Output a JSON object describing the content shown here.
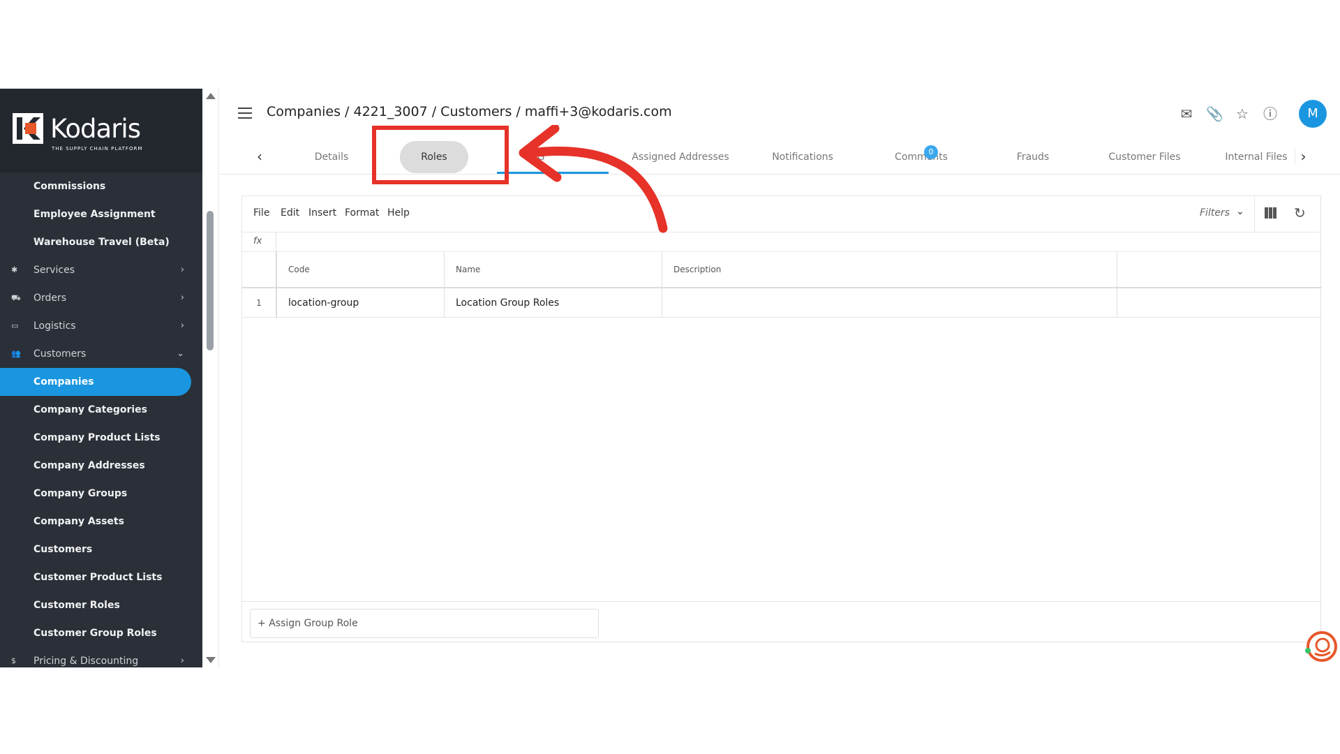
{
  "logo": {
    "name": "Kodaris",
    "tagline": "THE SUPPLY CHAIN PLATFORM",
    "brand_color": "#e6572a"
  },
  "sidebar": {
    "items": [
      {
        "label": "Commissions",
        "kind": "sub"
      },
      {
        "label": "Employee Assignment",
        "kind": "sub"
      },
      {
        "label": "Warehouse Travel (Beta)",
        "kind": "sub"
      },
      {
        "label": "Services",
        "kind": "top",
        "icon": "services-icon",
        "chevron": "›"
      },
      {
        "label": "Orders",
        "kind": "top",
        "icon": "truck-icon",
        "chevron": "›"
      },
      {
        "label": "Logistics",
        "kind": "top",
        "icon": "shipping-icon",
        "chevron": "›"
      },
      {
        "label": "Customers",
        "kind": "top",
        "icon": "users-icon",
        "chevron": "⌄"
      },
      {
        "label": "Companies",
        "kind": "active"
      },
      {
        "label": "Company Categories",
        "kind": "sub"
      },
      {
        "label": "Company Product Lists",
        "kind": "sub"
      },
      {
        "label": "Company Addresses",
        "kind": "sub"
      },
      {
        "label": "Company Groups",
        "kind": "sub"
      },
      {
        "label": "Company Assets",
        "kind": "sub"
      },
      {
        "label": "Customers",
        "kind": "sub"
      },
      {
        "label": "Customer Product Lists",
        "kind": "sub"
      },
      {
        "label": "Customer Roles",
        "kind": "sub"
      },
      {
        "label": "Customer Group Roles",
        "kind": "sub"
      },
      {
        "label": "Pricing & Discounting",
        "kind": "top",
        "icon": "dollar-icon",
        "chevron": "›"
      }
    ]
  },
  "header": {
    "breadcrumb": "Companies / 4221_3007 / Customers / maffi+3@kodaris.com",
    "avatar_initial": "M"
  },
  "tabs": {
    "items": [
      {
        "label": "Details"
      },
      {
        "label": "Roles"
      },
      {
        "label": "G"
      },
      {
        "label": "Assigned Addresses"
      },
      {
        "label": "Notifications"
      },
      {
        "label": "Comments",
        "badge": "0"
      },
      {
        "label": "Frauds"
      },
      {
        "label": "Customer Files"
      },
      {
        "label": "Internal Files"
      }
    ]
  },
  "grid": {
    "menu": [
      "File",
      "Edit",
      "Insert",
      "Format",
      "Help"
    ],
    "filters_label": "Filters",
    "fx_label": "fx",
    "columns": [
      "Code",
      "Name",
      "Description"
    ],
    "rows": [
      {
        "num": "1",
        "code": "location-group",
        "name": "Location Group Roles",
        "description": ""
      }
    ],
    "assign_button": "+ Assign Group Role"
  },
  "colors": {
    "accent": "#1a96e0",
    "highlight": "#e63228",
    "sidebar": "#2b3038"
  }
}
